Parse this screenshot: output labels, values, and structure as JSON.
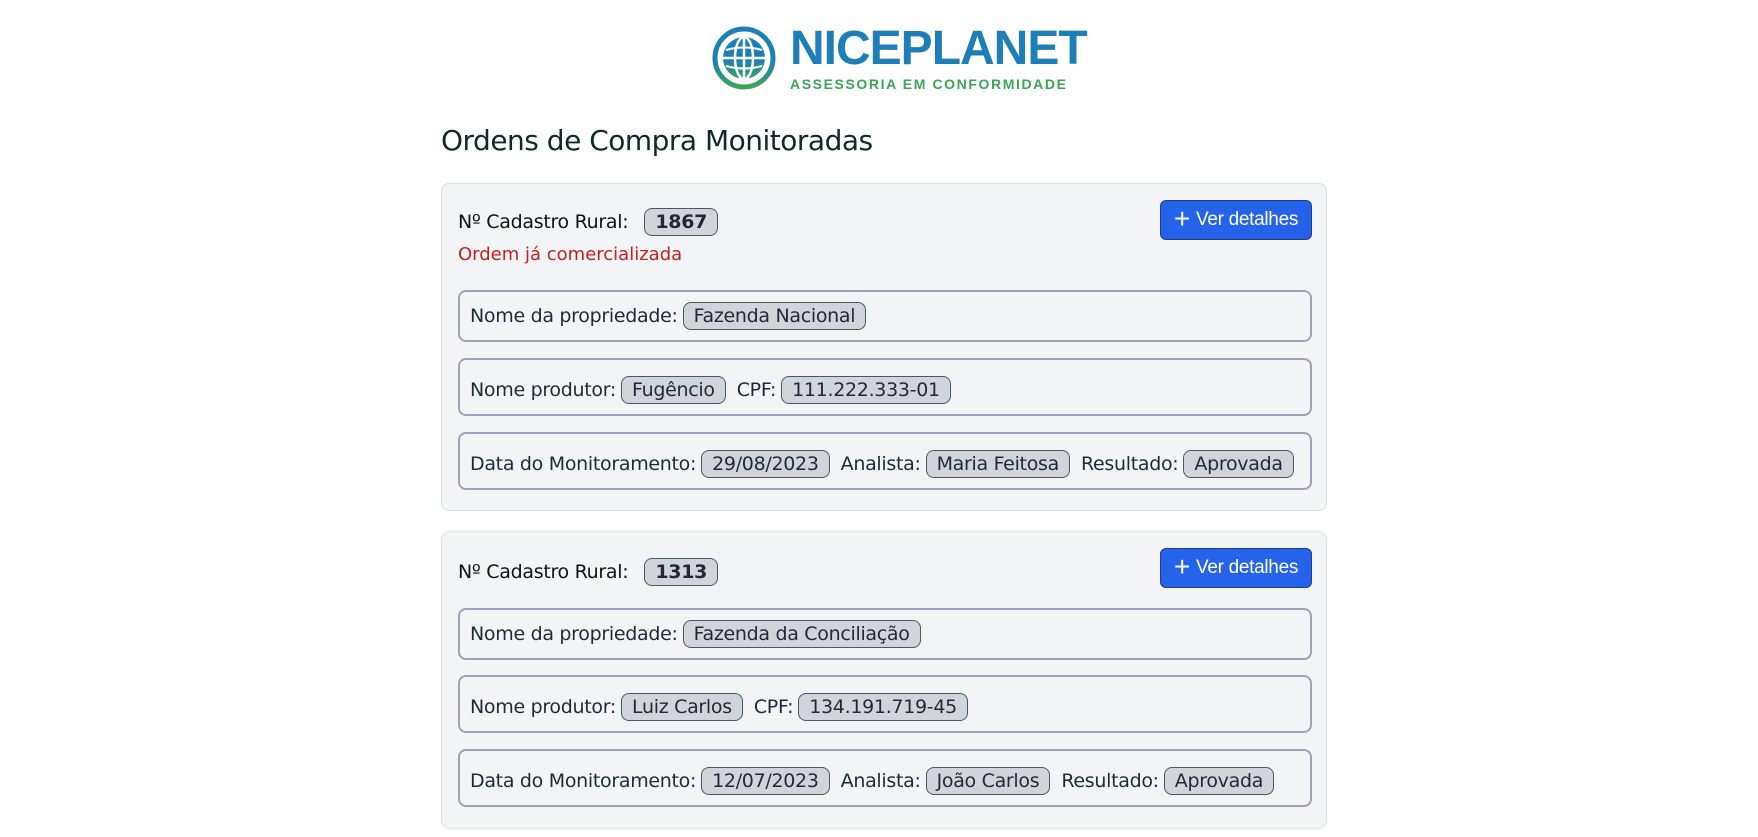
{
  "brand": {
    "name": "NICEPLANET",
    "tagline": "ASSESSORIA EM CONFORMIDADE"
  },
  "page_title": "Ordens de Compra Monitoradas",
  "colors": {
    "accent": "#2563eb",
    "brand_blue": "#1e7fb8",
    "brand_green": "#3aa655",
    "status_red": "#c81e1e"
  },
  "labels": {
    "cadastro": "Nº Cadastro Rural:",
    "propriedade": "Nome da propriedade:",
    "produtor": "Nome produtor:",
    "cpf": "CPF:",
    "data": "Data do Monitoramento:",
    "analista": "Analista:",
    "resultado": "Resultado:",
    "details_button": "Ver detalhes"
  },
  "orders": [
    {
      "cadastro": "1867",
      "status": "Ordem já comercializada",
      "propriedade": "Fazenda Nacional",
      "produtor": "Fugêncio",
      "cpf": "111.222.333-01",
      "data": "29/08/2023",
      "analista": "Maria Feitosa",
      "resultado": "Aprovada"
    },
    {
      "cadastro": "1313",
      "status": "",
      "propriedade": "Fazenda da Conciliação",
      "produtor": "Luiz Carlos",
      "cpf": "134.191.719-45",
      "data": "12/07/2023",
      "analista": "João Carlos",
      "resultado": "Aprovada"
    }
  ]
}
